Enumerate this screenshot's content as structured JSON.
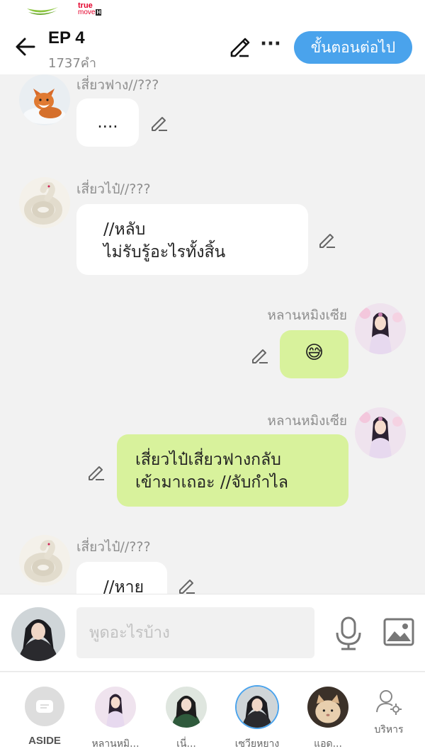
{
  "status_bar": {
    "carrier_true_line1": "true",
    "carrier_true_line2": "move",
    "carrier_true_badge": "H"
  },
  "header": {
    "title": "EP 4",
    "word_count": "1737คำ",
    "next_step_label": "ขั้นตอนต่อไป",
    "more_label": "···"
  },
  "messages": [
    {
      "sender": "เสี่ยวฟาง//???",
      "text": "....",
      "side": "left",
      "avatar": "fox"
    },
    {
      "sender": "เสี่ยวไป๋//???",
      "text": "//หลับ\nไม่รับรู้อะไรทั้งสิ้น",
      "side": "left",
      "avatar": "snake"
    },
    {
      "sender": "หลานหมิงเซีย",
      "text": "😅",
      "side": "right",
      "avatar": "lady"
    },
    {
      "sender": "หลานหมิงเซีย",
      "text": "เสี่ยวไป๋เสี่ยวฟางกลับ\nเข้ามาเถอะ //จับกำไล",
      "side": "right",
      "avatar": "lady"
    },
    {
      "sender": "เสี่ยวไป๋//???",
      "text": "//หาย",
      "side": "left",
      "avatar": "snake"
    }
  ],
  "input": {
    "placeholder": "พูดอะไรบ้าง"
  },
  "characters": [
    {
      "label": "ASIDE",
      "type": "aside"
    },
    {
      "label": "หลานหมิ...",
      "type": "lady"
    },
    {
      "label": "เนี่...",
      "type": "man-green"
    },
    {
      "label": "เซวียหยาง",
      "type": "man-dark",
      "selected": true
    },
    {
      "label": "แอด...",
      "type": "cat"
    },
    {
      "label": "บริหาร",
      "type": "manage"
    }
  ],
  "colors": {
    "accent": "#4aa3ec",
    "right_bubble": "#d8f29c",
    "left_bubble": "#ffffff",
    "background": "#f2f2f2"
  }
}
